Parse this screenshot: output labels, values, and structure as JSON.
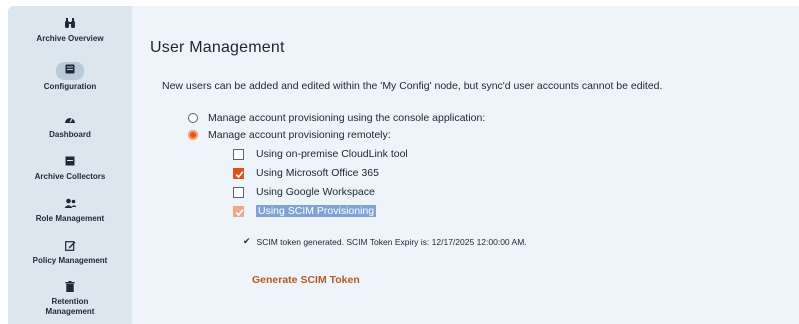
{
  "sidebar": {
    "items": [
      {
        "label": "Archive Overview",
        "icon": "binoculars-icon"
      },
      {
        "label": "Configuration",
        "icon": "configuration-icon",
        "active": true
      },
      {
        "label": "Dashboard",
        "icon": "gauge-icon"
      },
      {
        "label": "Archive Collectors",
        "icon": "collector-icon"
      },
      {
        "label": "Role Management",
        "icon": "users-icon"
      },
      {
        "label": "Policy Management",
        "icon": "edit-icon"
      },
      {
        "label": "Retention Management",
        "icon": "trash-icon"
      }
    ]
  },
  "main": {
    "title": "User Management",
    "intro": "New users can be added and edited within the 'My Config' node, but sync'd user accounts cannot be edited.",
    "provisioning": {
      "options": [
        {
          "label": "Manage account provisioning using the console application:",
          "selected": false
        },
        {
          "label": "Manage account provisioning remotely:",
          "selected": true
        }
      ],
      "remote_methods": [
        {
          "label": "Using on-premise CloudLink tool",
          "checked": false
        },
        {
          "label": "Using Microsoft Office 365",
          "checked": true
        },
        {
          "label": "Using Google Workspace",
          "checked": false
        },
        {
          "label": "Using SCIM Provisioning",
          "checked": true,
          "highlighted": true
        }
      ]
    },
    "token_status": "SCIM token generated. SCIM Token Expiry is: 12/17/2025 12:00:00 AM.",
    "generate_token_label": "Generate SCIM Token"
  },
  "colors": {
    "accent": "#d9531b",
    "link": "#b35a26",
    "sidebar_bg": "#dbe6ef",
    "content_bg": "#eef4f9",
    "selection": "#7fa3d6"
  }
}
